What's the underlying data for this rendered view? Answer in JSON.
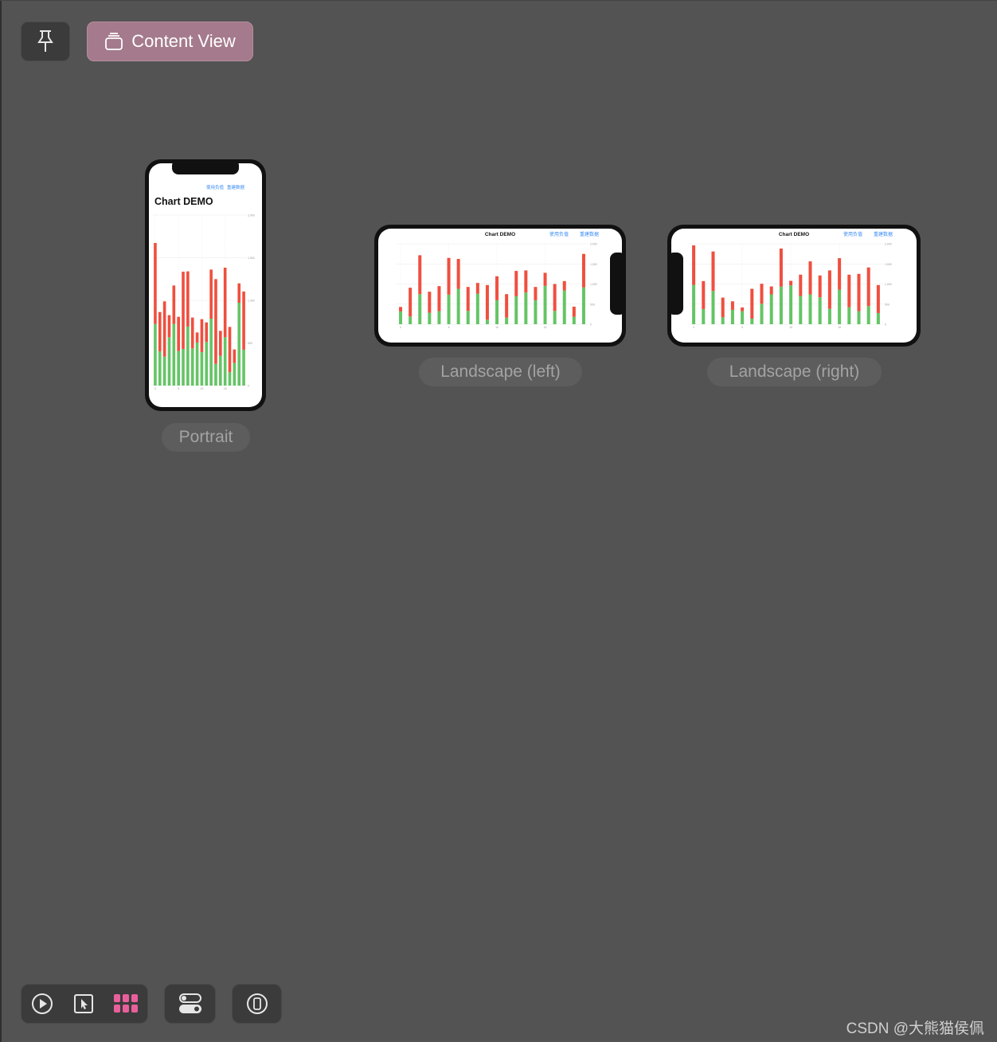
{
  "toolbar": {
    "pin_icon": "pin-icon",
    "content_view_label": "Content View",
    "content_view_icon": "stack-icon",
    "accent_color": "#a57a8c"
  },
  "previews": [
    {
      "label": "Portrait",
      "app": {
        "title": "Chart DEMO",
        "buttons": [
          "使用负值",
          "重建数据"
        ]
      },
      "chart_data": {
        "type": "bar",
        "stacked": true,
        "x": [
          0,
          1,
          2,
          3,
          4,
          5,
          6,
          7,
          8,
          9,
          10,
          11,
          12,
          13,
          14,
          15,
          16,
          17,
          18,
          19
        ],
        "x_ticks": [
          "0",
          "5",
          "10",
          "15"
        ],
        "y_ticks": [
          "0",
          "500",
          "1,000",
          "1,500",
          "2,000"
        ],
        "ylim": [
          0,
          2000
        ],
        "grid": true,
        "series": [
          {
            "color": "#65c466",
            "values": [
              723,
              402,
              340,
              567,
              723,
              405,
              430,
              692,
              436,
              505,
              393,
              511,
              785,
              255,
              349,
              567,
              156,
              265,
              972,
              421
            ]
          },
          {
            "color": "#ef4f3f",
            "values": [
              950,
              461,
              648,
              259,
              451,
              402,
              906,
              648,
              362,
              118,
              386,
              230,
              576,
              994,
              293,
              816,
              532,
              159,
              227,
              682
            ]
          }
        ]
      }
    },
    {
      "label": "Landscape (left)",
      "app": {
        "title": "Chart DEMO",
        "buttons": [
          "使用负值",
          "重建数据"
        ]
      },
      "chart_data": {
        "type": "bar",
        "stacked": true,
        "x": [
          0,
          1,
          2,
          3,
          4,
          5,
          6,
          7,
          8,
          9,
          10,
          11,
          12,
          13,
          14,
          15,
          16,
          17,
          18,
          19
        ],
        "x_ticks": [
          "0",
          "5",
          "10",
          "15"
        ],
        "y_ticks": [
          "0",
          "500",
          "1,000",
          "1,500",
          "2,000"
        ],
        "ylim": [
          0,
          2000
        ],
        "grid": true,
        "series": [
          {
            "color": "#65c466",
            "values": [
              318,
              192,
              748,
              285,
              325,
              735,
              881,
              331,
              762,
              113,
              596,
              166,
              695,
              788,
              596,
              954,
              331,
              841,
              185,
              914
            ]
          },
          {
            "color": "#ef4f3f",
            "values": [
              112,
              715,
              967,
              523,
              622,
              914,
              742,
              596,
              264,
              861,
              596,
              582,
              630,
              550,
              331,
              324,
              669,
              232,
              252,
              834
            ]
          }
        ]
      }
    },
    {
      "label": "Landscape (right)",
      "app": {
        "title": "Chart DEMO",
        "buttons": [
          "使用负值",
          "重建数据"
        ]
      },
      "chart_data": {
        "type": "bar",
        "stacked": true,
        "x": [
          0,
          1,
          2,
          3,
          4,
          5,
          6,
          7,
          8,
          9,
          10,
          11,
          12,
          13,
          14,
          15,
          16,
          17,
          18,
          19
        ],
        "x_ticks": [
          "0",
          "5",
          "10",
          "15"
        ],
        "y_ticks": [
          "0",
          "500",
          "1,000",
          "1,500",
          "2,000"
        ],
        "ylim": [
          0,
          2000
        ],
        "grid": true,
        "series": [
          {
            "color": "#65c466",
            "values": [
              980,
              377,
              828,
              172,
              358,
              325,
              139,
              510,
              742,
              934,
              967,
              702,
              742,
              669,
              384,
              861,
              424,
              325,
              450,
              278
            ]
          },
          {
            "color": "#ef4f3f",
            "values": [
              980,
              696,
              980,
              490,
              212,
              92,
              742,
              497,
              198,
              947,
              112,
              530,
              821,
              543,
              954,
              781,
              808,
              927,
              961,
              696
            ]
          }
        ]
      }
    }
  ],
  "bottom_toolbar": {
    "icons": [
      "play-icon",
      "select-cursor-icon",
      "grid-icon",
      "variants-toggle-icon",
      "device-settings-icon"
    ],
    "active_color": "#e8609b"
  },
  "watermark": "CSDN @大熊猫侯佩"
}
